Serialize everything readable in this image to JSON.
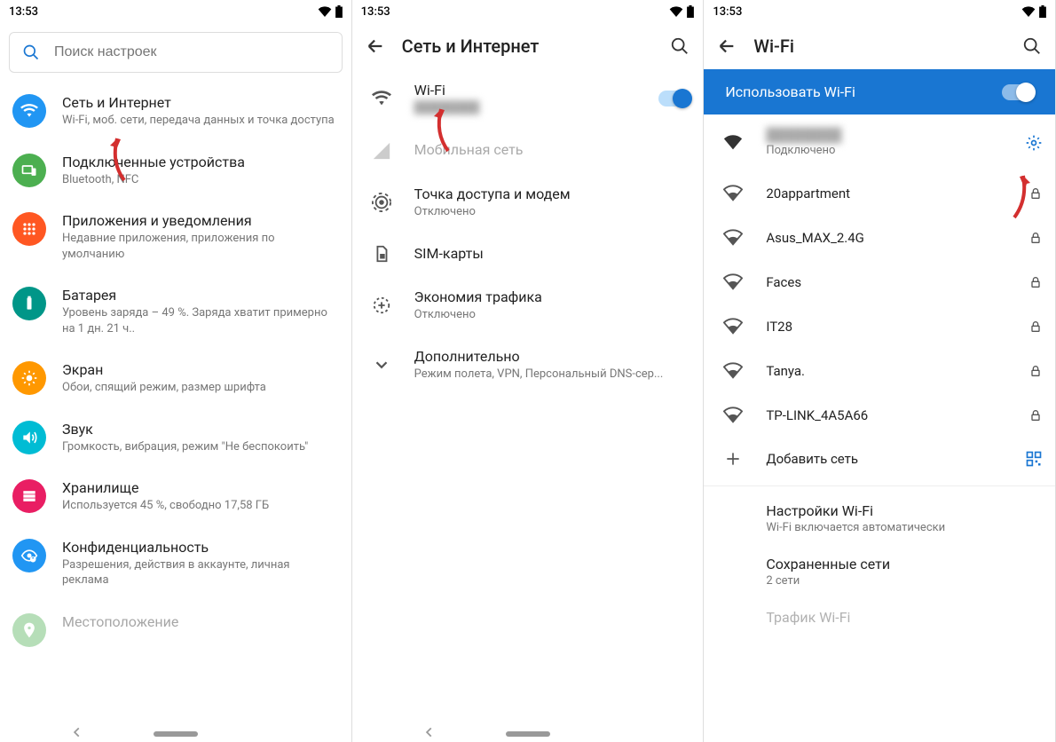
{
  "status": {
    "time": "13:53"
  },
  "panel1": {
    "search_placeholder": "Поиск настроек",
    "items": [
      {
        "title": "Сеть и Интернет",
        "subtitle": "Wi-Fi, моб. сети, передача данных и точка доступа",
        "color": "#2196f3",
        "icon": "wifi"
      },
      {
        "title": "Подключенные устройства",
        "subtitle": "Bluetooth, NFC",
        "color": "#4caf50",
        "icon": "devices"
      },
      {
        "title": "Приложения и уведомления",
        "subtitle": "Недавние приложения, приложения по умолчанию",
        "color": "#ff5722",
        "icon": "apps"
      },
      {
        "title": "Батарея",
        "subtitle": "Уровень заряда – 49 %. Заряда хватит примерно на 1 дн. 21 ч..",
        "color": "#009688",
        "icon": "battery"
      },
      {
        "title": "Экран",
        "subtitle": "Обои, спящий режим, размер шрифта",
        "color": "#ff9800",
        "icon": "display"
      },
      {
        "title": "Звук",
        "subtitle": "Громкость, вибрация, режим \"Не беспокоить\"",
        "color": "#00bcd4",
        "icon": "sound"
      },
      {
        "title": "Хранилище",
        "subtitle": "Используется 45 %, свободно 17,58 ГБ",
        "color": "#e91e63",
        "icon": "storage"
      },
      {
        "title": "Конфиденциальность",
        "subtitle": "Разрешения, действия в аккаунте, личная реклама",
        "color": "#2196f3",
        "icon": "privacy"
      },
      {
        "title": "Местоположение",
        "subtitle": "",
        "color": "#4caf50",
        "icon": "location"
      }
    ]
  },
  "panel2": {
    "header": "Сеть и Интернет",
    "items": [
      {
        "title": "Wi-Fi",
        "subtitle": "",
        "icon": "wifi",
        "toggle": true
      },
      {
        "title": "Мобильная сеть",
        "subtitle": "",
        "icon": "sim-dim",
        "disabled": true
      },
      {
        "title": "Точка доступа и модем",
        "subtitle": "Отключено",
        "icon": "hotspot"
      },
      {
        "title": "SIM-карты",
        "subtitle": "",
        "icon": "sim"
      },
      {
        "title": "Экономия трафика",
        "subtitle": "Отключено",
        "icon": "datasaver"
      },
      {
        "title": "Дополнительно",
        "subtitle": "Режим полета, VPN, Персональный DNS-сер...",
        "icon": "expand"
      }
    ]
  },
  "panel3": {
    "header": "Wi-Fi",
    "use_wifi": "Использовать Wi-Fi",
    "connected": {
      "name": "",
      "status": "Подключено"
    },
    "networks": [
      {
        "name": "20appartment",
        "locked": true
      },
      {
        "name": "Asus_MAX_2.4G",
        "locked": true
      },
      {
        "name": "Faces",
        "locked": true
      },
      {
        "name": "IT28",
        "locked": true
      },
      {
        "name": "Tanya.",
        "locked": true
      },
      {
        "name": "TP-LINK_4A5A66",
        "locked": true
      }
    ],
    "add_network": "Добавить сеть",
    "sections": [
      {
        "title": "Настройки Wi-Fi",
        "sub": "Wi-Fi включается автоматически"
      },
      {
        "title": "Сохраненные сети",
        "sub": "2 сети"
      },
      {
        "title": "Трафик Wi-Fi",
        "sub": ""
      }
    ]
  }
}
